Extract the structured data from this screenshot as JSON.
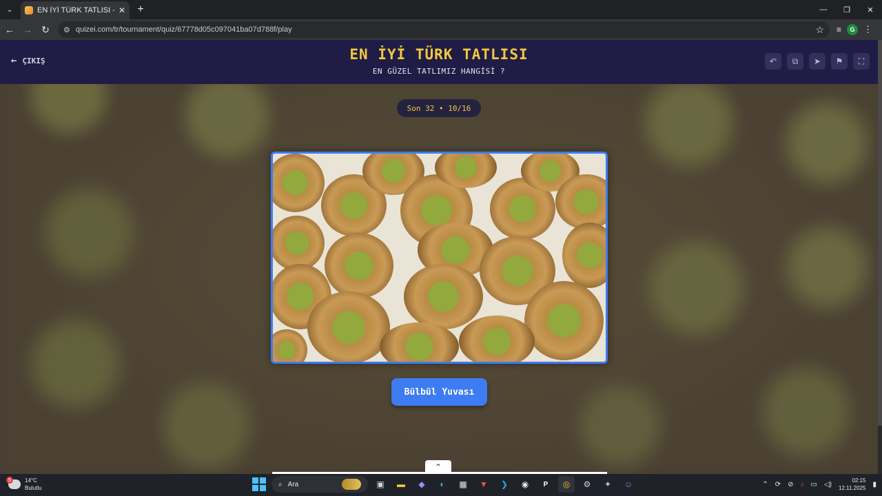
{
  "browser": {
    "tab_title": "EN İYİ TÜRK TATLISI - Tier List, ...",
    "url": "quizei.com/tr/tournament/quiz/67778d05c097041ba07d788f/play",
    "profile_initial": "G"
  },
  "header": {
    "exit_label": "ÇIKIŞ",
    "title": "EN İYİ TÜRK TATLISI",
    "subtitle": "EN GÜZEL TATLIMIZ HANGİSİ ?"
  },
  "round": {
    "label": "Son 32 • 10/16"
  },
  "choice": {
    "label": "Bülbül Yuvası"
  },
  "taskbar": {
    "weather_temp": "14°C",
    "weather_desc": "Bulutlu",
    "weather_badge": "5",
    "search_placeholder": "Ara",
    "time": "02:15",
    "date": "12.11.2025"
  },
  "colors": {
    "header_bg": "#1f1d45",
    "title_gold": "#f4c83f",
    "accent_blue": "#3d7cf2"
  }
}
